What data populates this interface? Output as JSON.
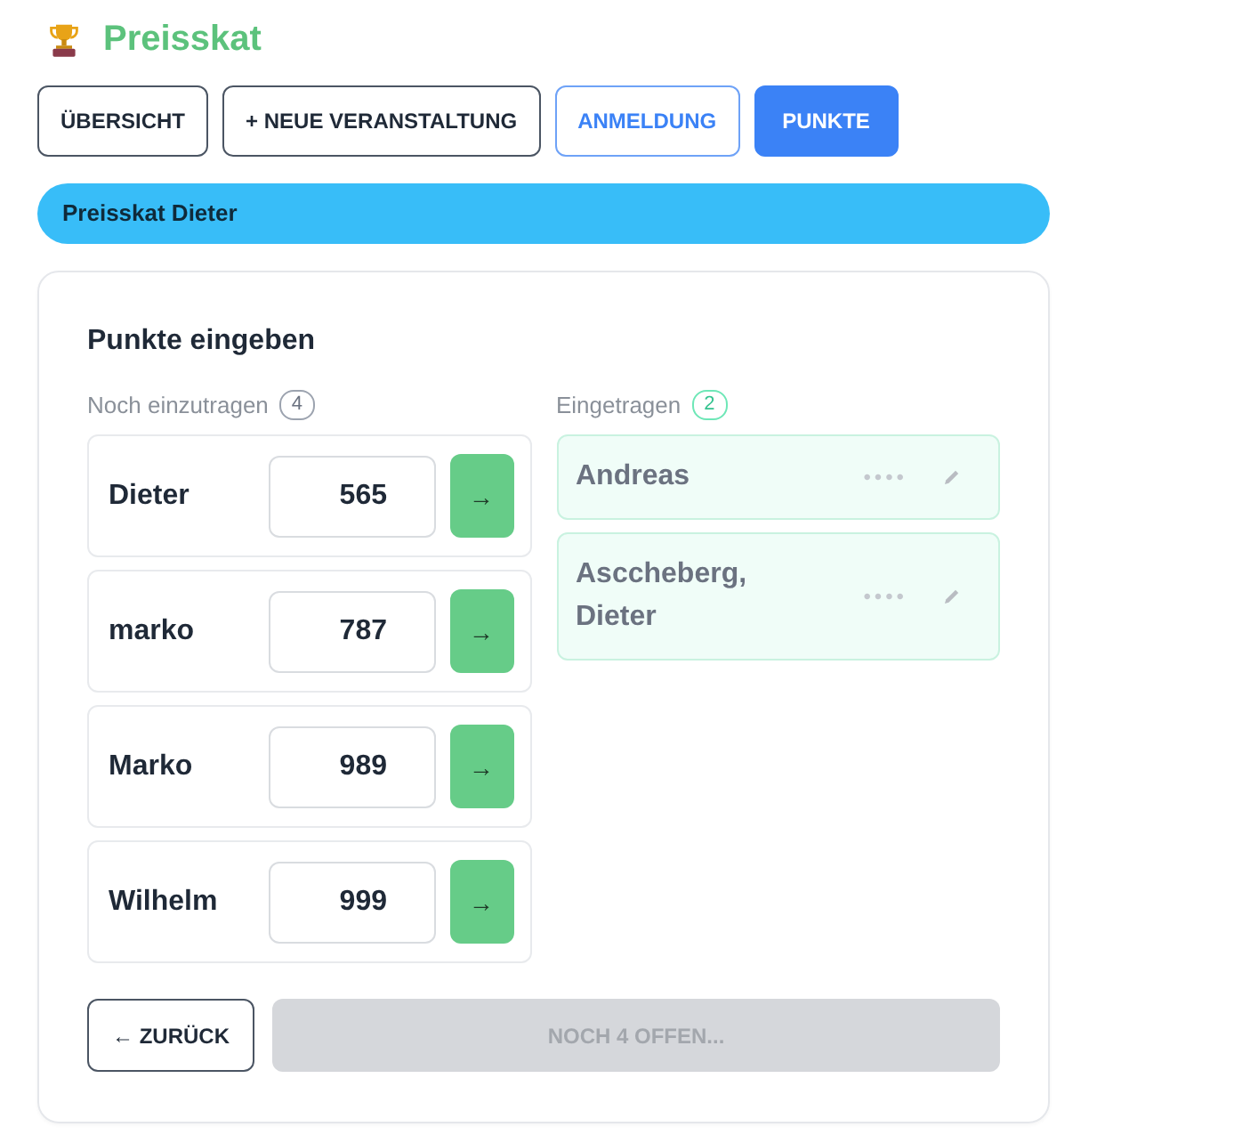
{
  "header": {
    "title": "Preisskat"
  },
  "nav": [
    {
      "label": "ÜBERSICHT",
      "selected": false,
      "accent": false
    },
    {
      "label": "+ NEUE VERANSTALTUNG",
      "selected": false,
      "accent": false
    },
    {
      "label": "ANMELDUNG",
      "selected": false,
      "accent": true
    },
    {
      "label": "PUNKTE",
      "selected": true,
      "accent": true
    }
  ],
  "event_banner": {
    "title": "Preisskat Dieter"
  },
  "card": {
    "title": "Punkte eingeben",
    "pending": {
      "label": "Noch einzutragen",
      "count": "4",
      "rows": [
        {
          "name": "Dieter",
          "value": "565",
          "submit": "→"
        },
        {
          "name": "marko",
          "value": "787",
          "submit": "→"
        },
        {
          "name": "Marko",
          "value": "989",
          "submit": "→"
        },
        {
          "name": "Wilhelm",
          "value": "999",
          "submit": "→"
        }
      ]
    },
    "entered": {
      "label": "Eingetragen",
      "count": "2",
      "rows": [
        {
          "name": "Andreas",
          "score": "••••"
        },
        {
          "name": "Asccheberg, Dieter",
          "score": "••••"
        }
      ]
    },
    "back_button": {
      "label": "← ZURÜCK"
    },
    "finish_button": {
      "label": "NOCH 4 OFFEN...",
      "disabled": true
    }
  }
}
